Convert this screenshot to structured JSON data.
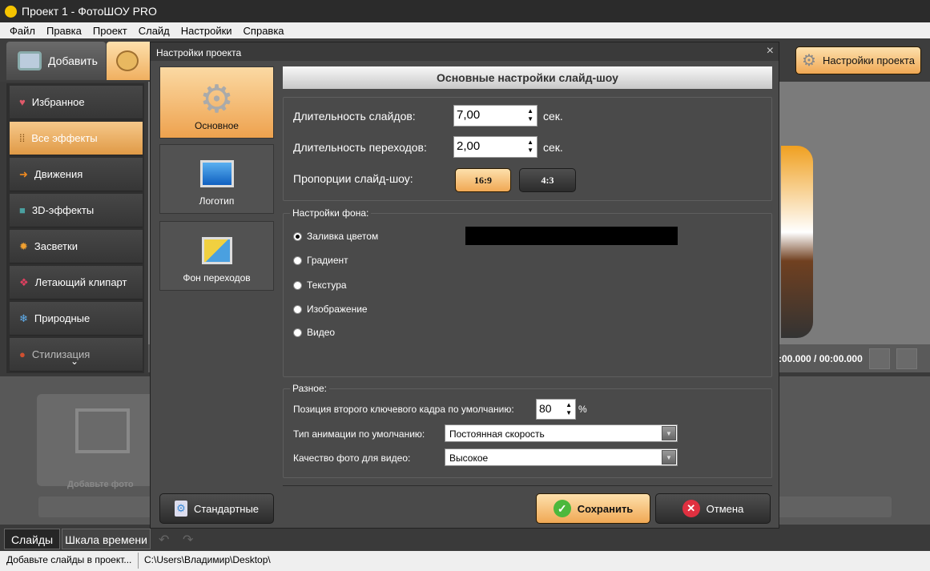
{
  "window": {
    "title": "Проект 1 - ФотоШОУ PRO"
  },
  "menu": [
    "Файл",
    "Правка",
    "Проект",
    "Слайд",
    "Настройки",
    "Справка"
  ],
  "toolbar": {
    "add_label": "Добавить",
    "project_settings_label": "Настройки проекта"
  },
  "sidebar": {
    "items": [
      {
        "label": "Избранное",
        "icon": "heart-icon",
        "color": "#e05a6a"
      },
      {
        "label": "Все эффекты",
        "icon": "grid-icon",
        "color": "#7a4a10",
        "selected": true
      },
      {
        "label": "Движения",
        "icon": "arrow-right-icon",
        "color": "#f08a20"
      },
      {
        "label": "3D-эффекты",
        "icon": "cube-icon",
        "color": "#4aa0a0"
      },
      {
        "label": "Засветки",
        "icon": "sun-icon",
        "color": "#f0a030"
      },
      {
        "label": "Летающий клипарт",
        "icon": "clipart-icon",
        "color": "#e04060"
      },
      {
        "label": "Природные",
        "icon": "snowflake-icon",
        "color": "#60b0f0"
      },
      {
        "label": "Стилизация",
        "icon": "style-icon",
        "color": "#d05030"
      }
    ]
  },
  "preview": {
    "time": ":00.000 / 00:00.000"
  },
  "filmstrip": {
    "placeholder": "Добавьте фото"
  },
  "bottom_tabs": [
    "Слайды",
    "Шкала времени"
  ],
  "status": {
    "message": "Добавьте слайды в проект...",
    "path": "C:\\Users\\Владимир\\Desktop\\"
  },
  "dialog": {
    "title": "Настройки проекта",
    "close": "×",
    "tabs": [
      {
        "label": "Основное",
        "selected": true
      },
      {
        "label": "Логотип"
      },
      {
        "label": "Фон переходов"
      }
    ],
    "header": "Основные настройки слайд-шоу",
    "slide_duration": {
      "label": "Длительность слайдов:",
      "value": "7,00",
      "unit": "сек."
    },
    "transition_duration": {
      "label": "Длительность переходов:",
      "value": "2,00",
      "unit": "сек."
    },
    "aspect": {
      "label": "Пропорции слайд-шоу:",
      "options": [
        "16:9",
        "4:3"
      ],
      "selected": "16:9"
    },
    "background": {
      "label": "Настройки фона:",
      "options": [
        "Заливка цветом",
        "Градиент",
        "Текстура",
        "Изображение",
        "Видео"
      ],
      "selected": "Заливка цветом",
      "color": "#000000"
    },
    "misc": {
      "label": "Разное:",
      "keyframe": {
        "label": "Позиция второго ключевого кадра по умолчанию:",
        "value": "80",
        "unit": "%"
      },
      "animation": {
        "label": "Тип анимации по умолчанию:",
        "value": "Постоянная скорость"
      },
      "quality": {
        "label": "Качество фото для видео:",
        "value": "Высокое"
      }
    },
    "buttons": {
      "defaults": "Стандартные",
      "save": "Сохранить",
      "cancel": "Отмена"
    }
  }
}
